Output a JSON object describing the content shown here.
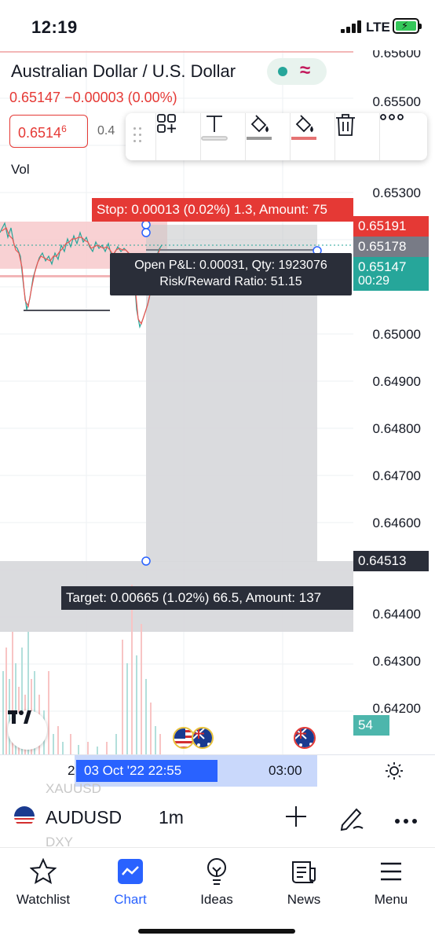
{
  "status_bar": {
    "time": "12:19",
    "network": "LTE"
  },
  "chart_header": {
    "title": "Australian Dollar / U.S. Dollar",
    "price_line": "0.65147 −0.00003 (0.00%)",
    "sell_price_main": "0.6514",
    "sell_price_pip": "6",
    "buy_price_partial": "0.4",
    "volume_label": "Vol"
  },
  "drawing_toolbar": {
    "icons": [
      "drag-handle-icon",
      "add-template-icon",
      "text-icon",
      "fill-color-icon",
      "line-color-icon",
      "trash-icon",
      "more-icon"
    ]
  },
  "price_axis": {
    "ticks": [
      "0.65600",
      "0.65500",
      "0.65300",
      "0.65000",
      "0.64900",
      "0.64800",
      "0.64700",
      "0.64600",
      "0.64400",
      "0.64300",
      "0.64200"
    ],
    "tags": {
      "stop": "0.65191",
      "entry": "0.65178",
      "last": "0.65147",
      "countdown": "00:29",
      "target": "0.64513",
      "volume": "54"
    },
    "colors": {
      "stop": "#e53935",
      "entry": "#787b86",
      "last": "#26a69a",
      "target": "#2a2e39",
      "volume": "#4db6ac"
    }
  },
  "position": {
    "stop_label": "Stop: 0.00013 (0.02%) 1.3, Amount: 75",
    "pnl_line1": "Open P&L: 0.00031, Qty: 1923076",
    "pnl_line2": "Risk/Reward Ratio: 51.15",
    "target_label": "Target: 0.00665 (1.02%) 66.5, Amount: 137"
  },
  "time_axis": {
    "left_partial": "2",
    "selected": "03 Oct '22   22:55",
    "right": "03:00"
  },
  "ghost_symbols": [
    "XAUUSD",
    "DXY"
  ],
  "symbol_bar": {
    "symbol": "AUDUSD",
    "interval": "1m"
  },
  "bottom_nav": [
    {
      "label": "Watchlist",
      "icon": "star-icon"
    },
    {
      "label": "Chart",
      "icon": "chart-icon"
    },
    {
      "label": "Ideas",
      "icon": "lightbulb-icon"
    },
    {
      "label": "News",
      "icon": "news-icon"
    },
    {
      "label": "Menu",
      "icon": "menu-icon"
    }
  ],
  "colors": {
    "accent": "#2962ff",
    "down": "#e53935",
    "up": "#26a69a"
  }
}
